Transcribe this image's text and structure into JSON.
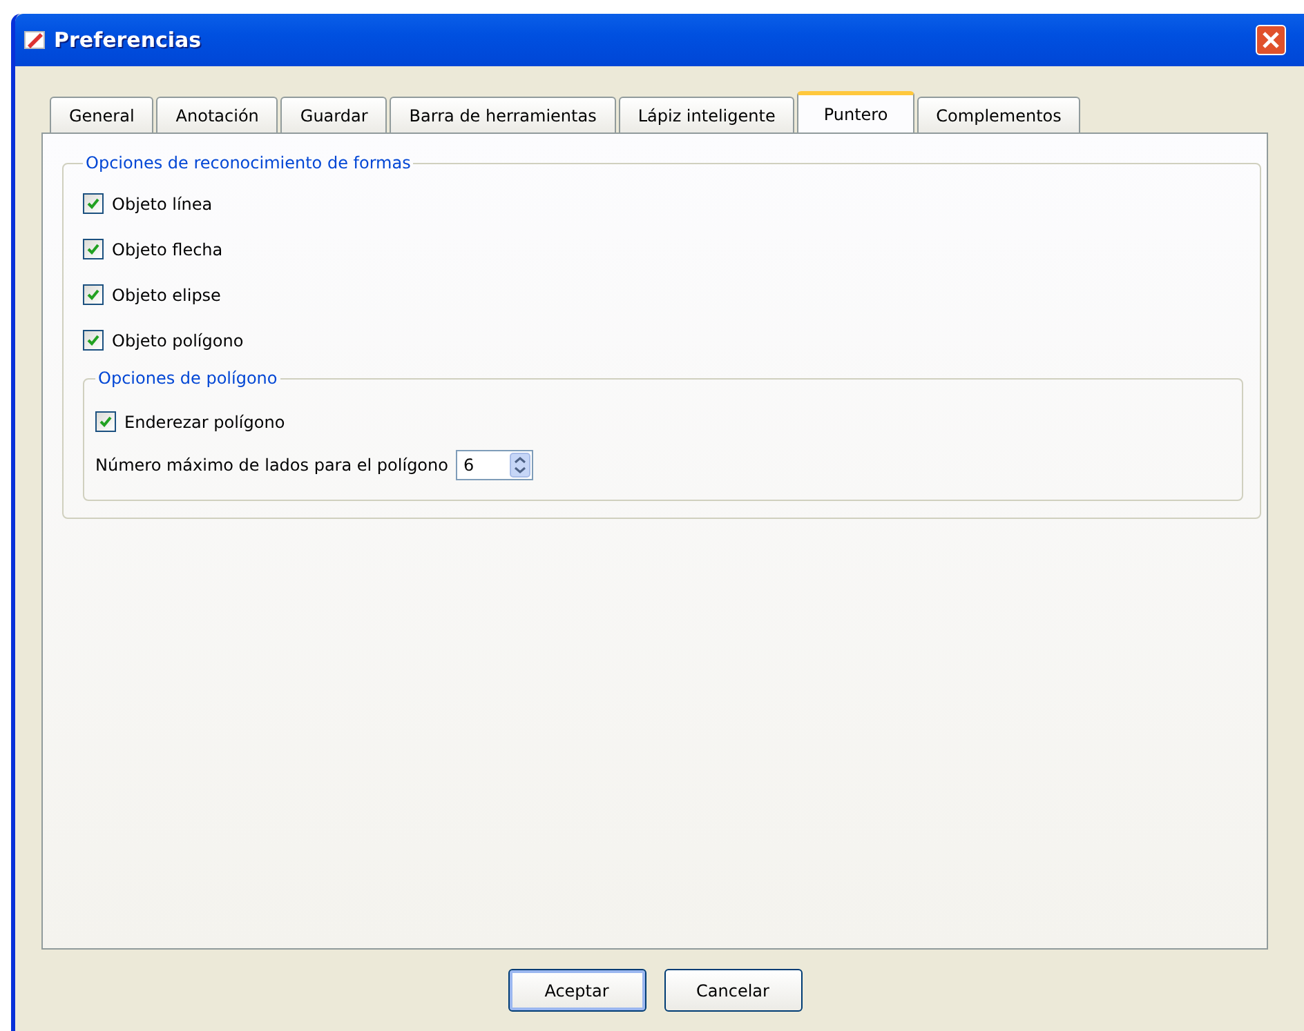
{
  "window": {
    "title": "Preferencias"
  },
  "tabs": [
    {
      "label": "General",
      "selected": false
    },
    {
      "label": "Anotación",
      "selected": false
    },
    {
      "label": "Guardar",
      "selected": false
    },
    {
      "label": "Barra de herramientas",
      "selected": false
    },
    {
      "label": "Lápiz inteligente",
      "selected": false
    },
    {
      "label": "Puntero",
      "selected": true
    },
    {
      "label": "Complementos",
      "selected": false
    }
  ],
  "shape_options": {
    "title": "Opciones de reconocimiento de formas",
    "items": [
      {
        "label": "Objeto línea",
        "checked": true
      },
      {
        "label": "Objeto flecha",
        "checked": true
      },
      {
        "label": "Objeto elipse",
        "checked": true
      },
      {
        "label": "Objeto polígono",
        "checked": true
      }
    ],
    "polygon_options": {
      "title": "Opciones de polígono",
      "straighten": {
        "label": "Enderezar polígono",
        "checked": true
      },
      "max_sides": {
        "label": "Número máximo de lados para el polígono",
        "value": "6"
      }
    }
  },
  "buttons": [
    {
      "label": "Aceptar",
      "default": true
    },
    {
      "label": "Cancelar",
      "default": false
    }
  ]
}
